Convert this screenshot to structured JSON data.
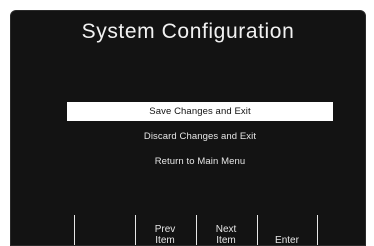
{
  "title": "System Configuration",
  "menu": {
    "items": [
      {
        "label": "Save Changes and Exit",
        "selected": true
      },
      {
        "label": "Discard Changes and Exit",
        "selected": false
      },
      {
        "label": "Return to Main Menu",
        "selected": false
      }
    ]
  },
  "softkeys": [
    {
      "label": ""
    },
    {
      "label": "Prev\nItem"
    },
    {
      "label": "Next\nItem"
    },
    {
      "label": "Enter"
    }
  ]
}
